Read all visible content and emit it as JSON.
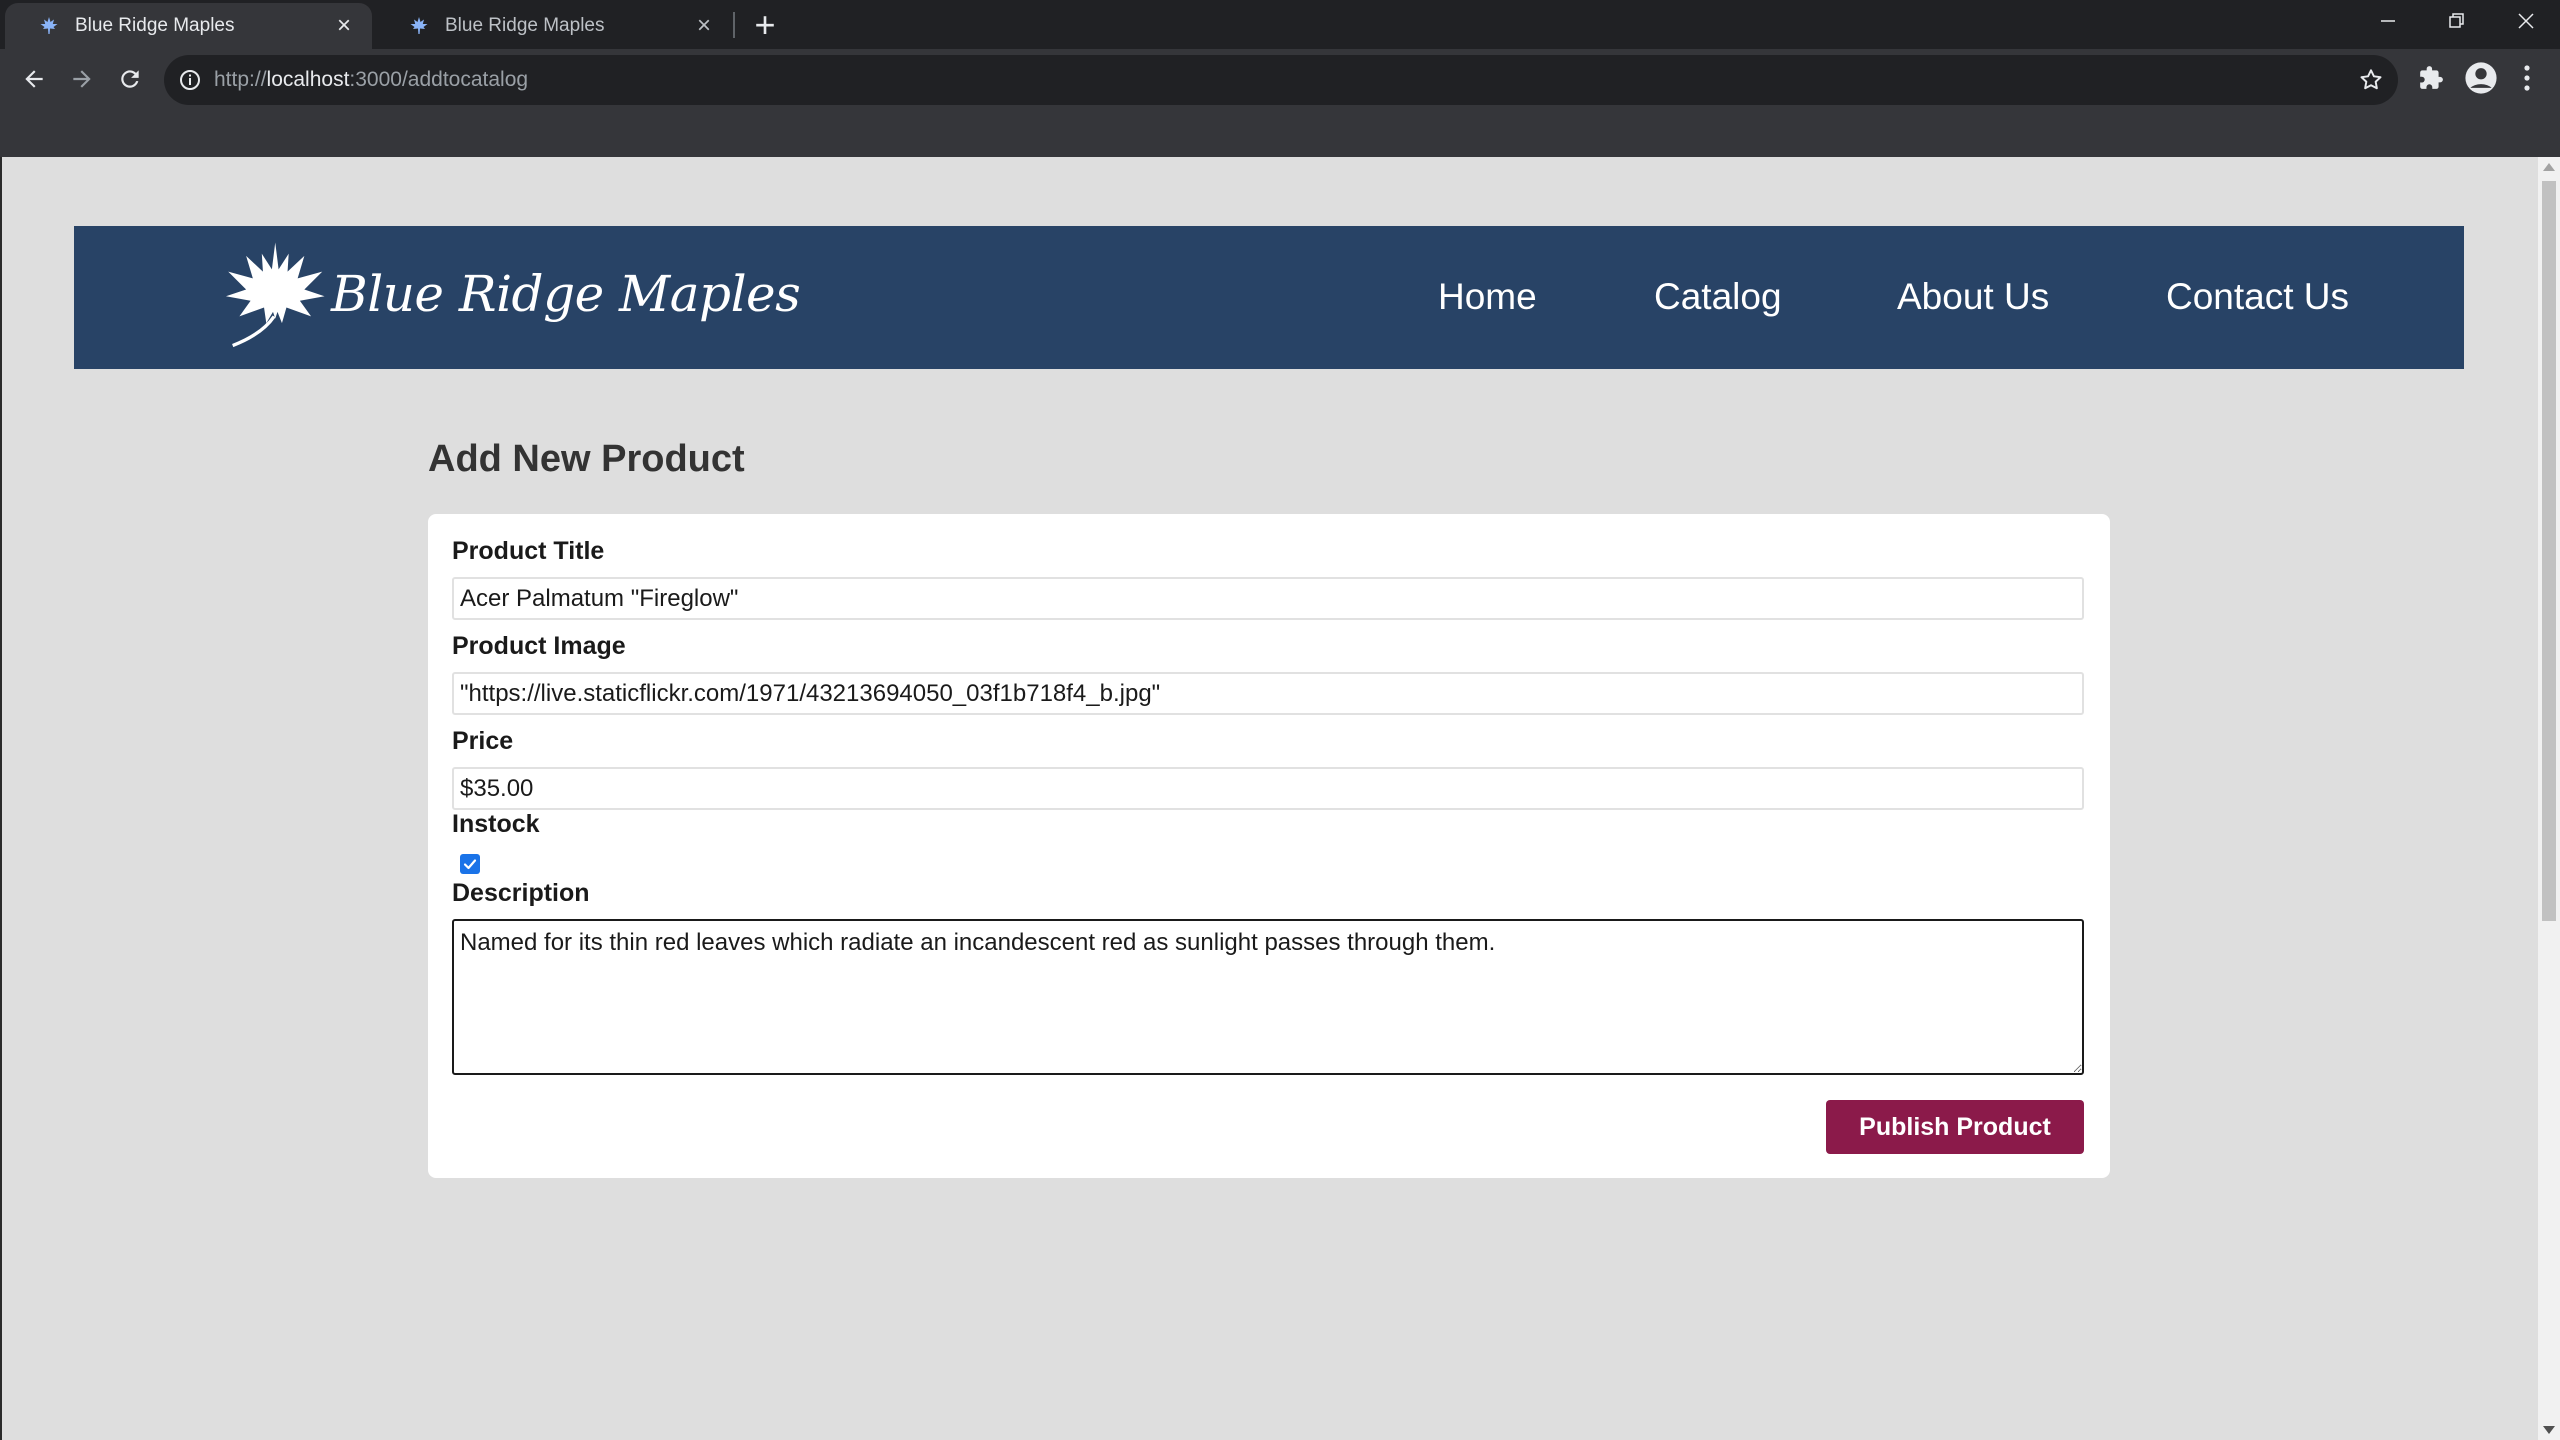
{
  "browser": {
    "tabs": [
      {
        "title": "Blue Ridge Maples",
        "active": true
      },
      {
        "title": "Blue Ridge Maples",
        "active": false
      }
    ],
    "url": {
      "scheme": "http://",
      "host": "localhost",
      "rest": ":3000/addtocatalog"
    },
    "icons": {
      "back": "back-arrow-icon",
      "forward": "forward-arrow-icon",
      "reload": "reload-icon",
      "bookmark": "star-icon",
      "extensions": "puzzle-icon",
      "profile": "account-icon",
      "menu": "kebab-menu-icon"
    }
  },
  "site": {
    "brand": "Blue Ridge Maples",
    "nav": [
      "Home",
      "Catalog",
      "About Us",
      "Contact Us"
    ],
    "colors": {
      "header_bg": "#284366",
      "button_bg": "#8b1a4a",
      "page_bg": "#dedede"
    }
  },
  "form": {
    "heading": "Add New Product",
    "title_label": "Product Title",
    "title_value": "Acer Palmatum \"Fireglow\"",
    "image_label": "Product Image",
    "image_value": "\"https://live.staticflickr.com/1971/43213694050_03f1b718f4_b.jpg\"",
    "price_label": "Price",
    "price_value": "$35.00",
    "instock_label": "Instock",
    "instock_checked": true,
    "description_label": "Description",
    "description_value": "Named for its thin red leaves which radiate an incandescent red as sunlight passes through them.",
    "submit_label": "Publish Product"
  }
}
